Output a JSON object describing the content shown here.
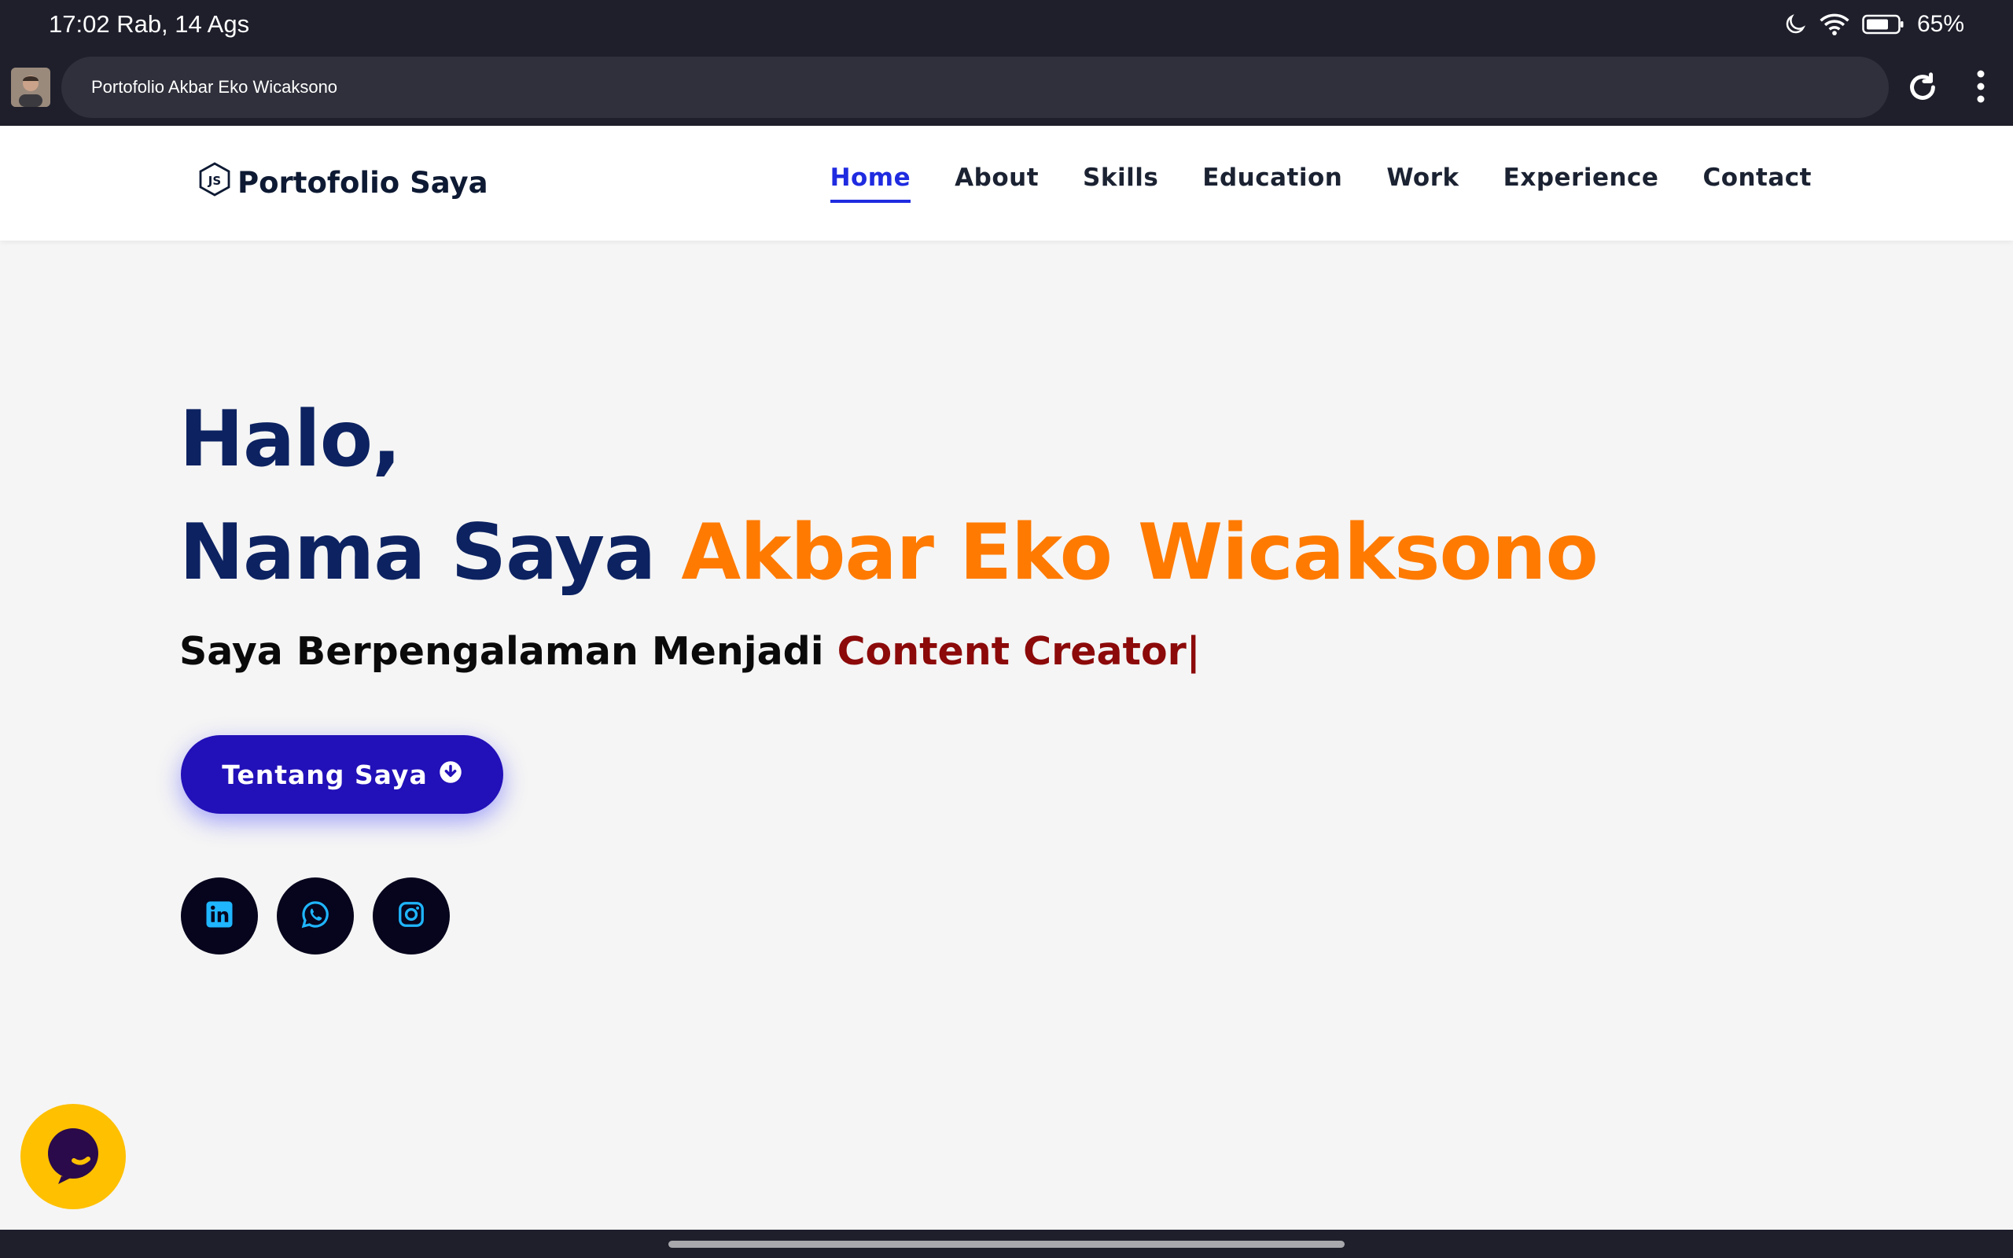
{
  "status_bar": {
    "time_date": "17:02 Rab, 14 Ags",
    "battery_percent": "65%",
    "icons": [
      "moon-icon",
      "wifi-icon",
      "battery-icon"
    ]
  },
  "browser": {
    "tab_title": "Portofolio Akbar Eko Wicaksono",
    "icons": [
      "profile-avatar",
      "reload-icon",
      "more-menu-icon"
    ]
  },
  "site": {
    "logo_text": "Portofolio Saya",
    "logo_icon": "js-hexagon-icon",
    "nav": [
      {
        "label": "Home",
        "active": true
      },
      {
        "label": "About",
        "active": false
      },
      {
        "label": "Skills",
        "active": false
      },
      {
        "label": "Education",
        "active": false
      },
      {
        "label": "Work",
        "active": false
      },
      {
        "label": "Experience",
        "active": false
      },
      {
        "label": "Contact",
        "active": false
      }
    ]
  },
  "hero": {
    "greeting": "Halo,",
    "name_prefix": "Nama Saya",
    "name": "Akbar Eko Wicaksono",
    "subtitle_prefix": "Saya Berpengalaman Menjadi",
    "role": "Content Creator|",
    "cta_label": "Tentang Saya",
    "cta_icon": "arrow-down-circle-icon"
  },
  "socials": [
    "linkedin-icon",
    "whatsapp-icon",
    "instagram-icon"
  ],
  "chat_widget_icon": "chat-bubble-icon",
  "colors": {
    "navy": "#0c2261",
    "orange": "#ff7a00",
    "crimson": "#8c0a0a",
    "button_blue": "#2210b8",
    "nav_active": "#1f2be0",
    "social_bg": "#06051d",
    "social_icon": "#1fb6ff",
    "chat_yellow": "#ffc000"
  }
}
